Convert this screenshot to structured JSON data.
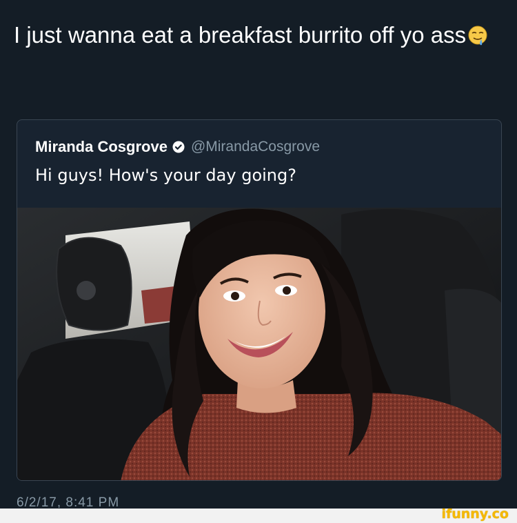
{
  "tweet": {
    "text": "I just wanna eat a breakfast burrito off yo ass",
    "emoji": "drooling-face"
  },
  "quoted_tweet": {
    "display_name": "Miranda Cosgrove",
    "verified_icon": "verified-badge-icon",
    "handle": "@MirandaCosgrove",
    "text": "Hi guys! How's your day going?",
    "photo": "selfie-in-car-photo"
  },
  "timestamp": "6/2/17, 8:41 PM",
  "watermark": "ifunny.co",
  "colors": {
    "background": "#141d26",
    "card_border": "#3a4653",
    "secondary_text": "#8899a6",
    "watermark": "#f5b800"
  }
}
